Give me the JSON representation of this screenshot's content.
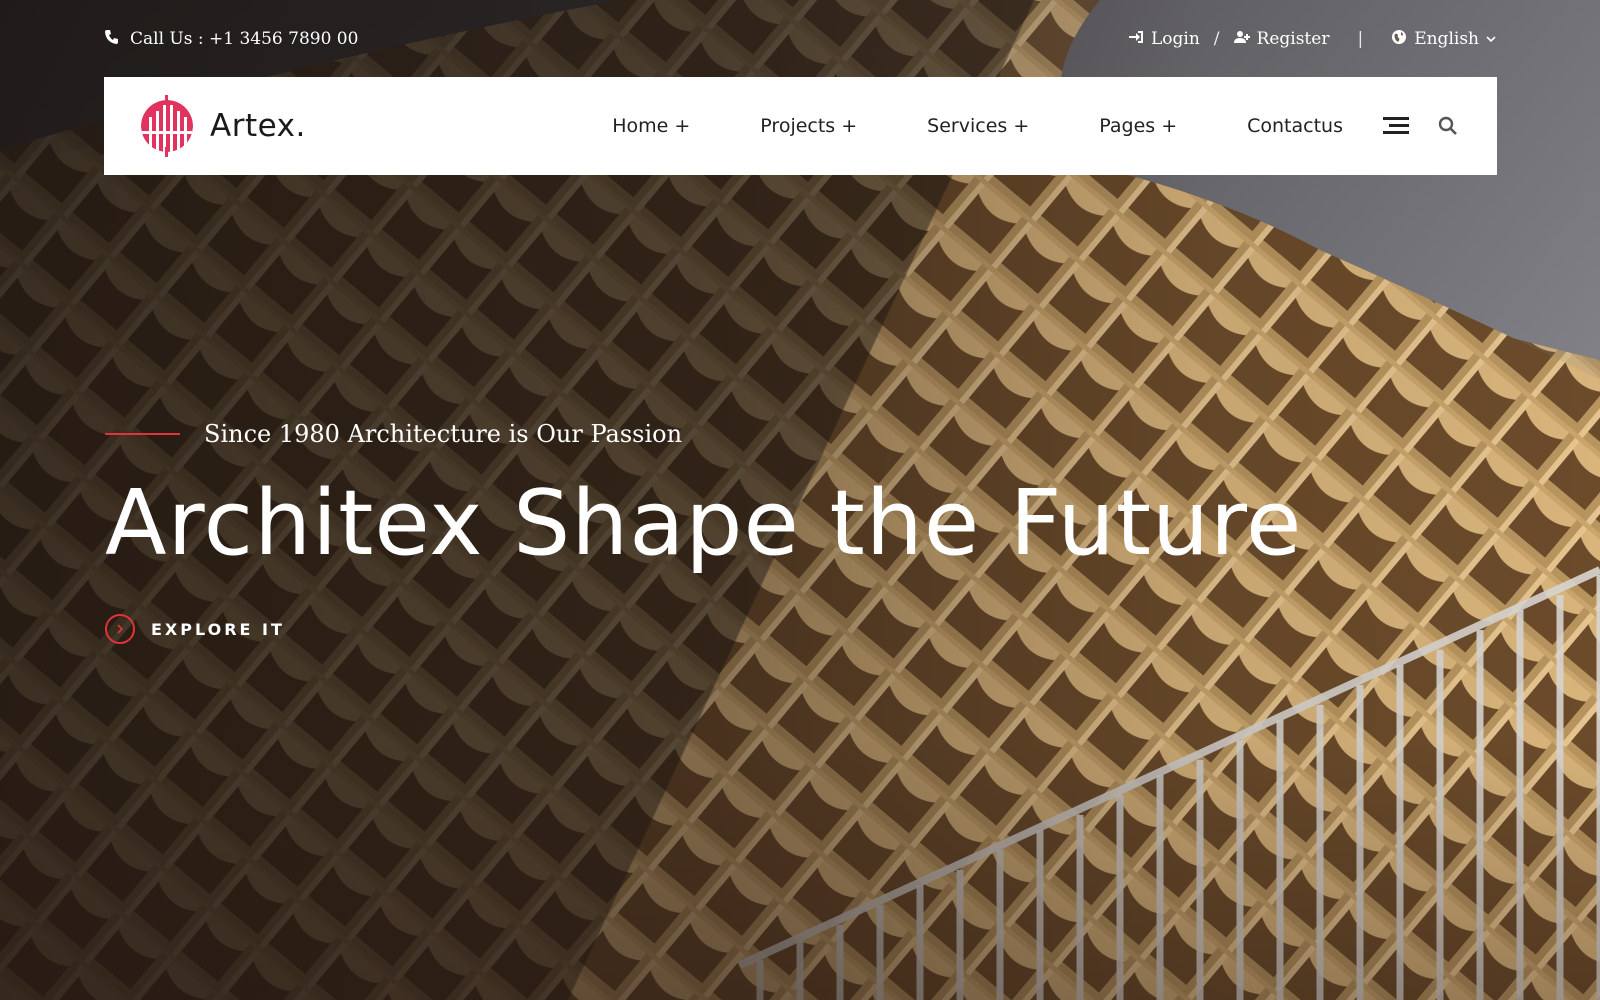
{
  "topbar": {
    "call_label": "Call Us : +1 3456 7890 00",
    "login_label": "Login",
    "separator": "/",
    "register_label": "Register",
    "divider": "|",
    "language_label": "English"
  },
  "brand": {
    "name": "Artex."
  },
  "nav": {
    "items": [
      {
        "label": "Home +"
      },
      {
        "label": "Projects +"
      },
      {
        "label": "Services +"
      },
      {
        "label": "Pages +"
      },
      {
        "label": "Contactus"
      }
    ],
    "icons": [
      "menu-icon",
      "search-icon"
    ]
  },
  "hero": {
    "tagline": "Since 1980 Architecture is Our Passion",
    "title": "Architex Shape the Future",
    "cta_label": "EXPLORE IT"
  },
  "colors": {
    "accent": "#e2323a",
    "navbar_bg": "#ffffff",
    "text_light": "#ffffff",
    "text_dark": "#222222"
  }
}
